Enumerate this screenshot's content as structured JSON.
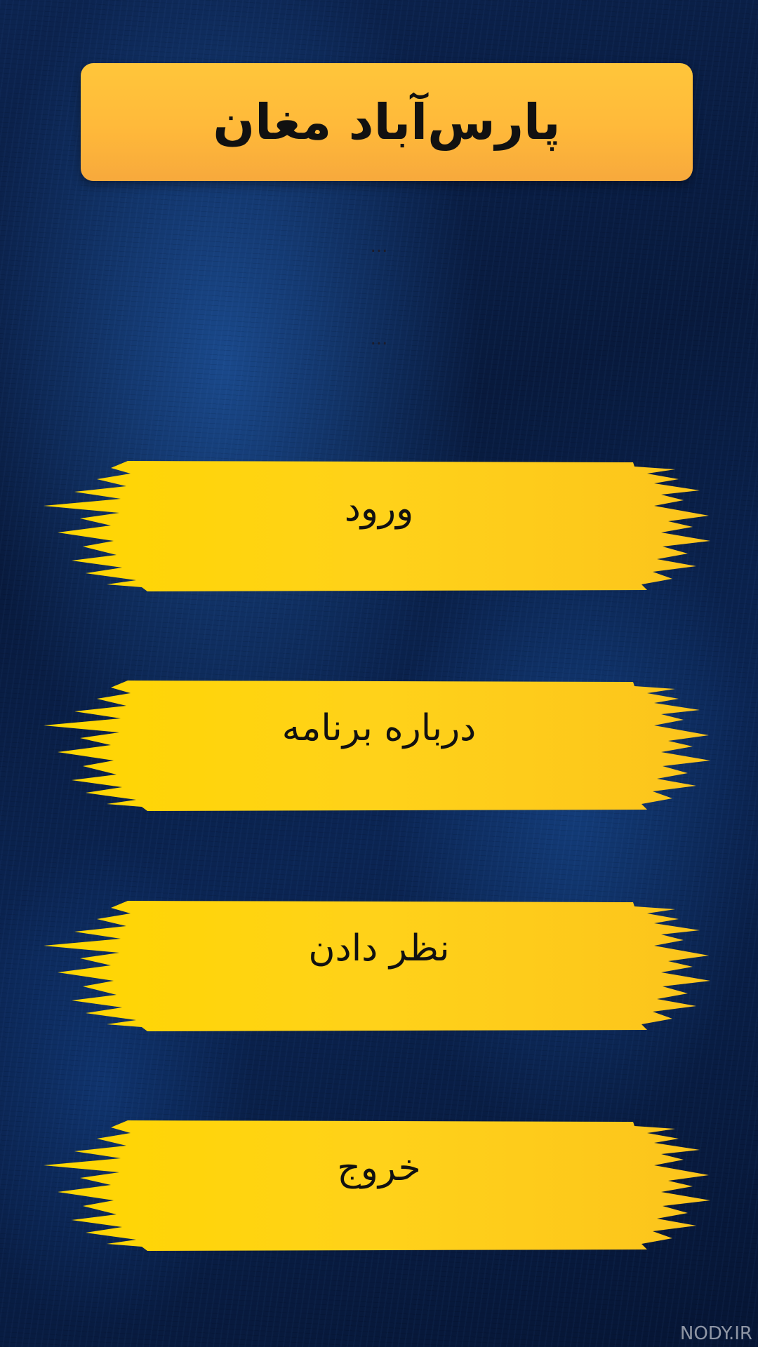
{
  "header": {
    "title": "پارس‌آباد مغان"
  },
  "placeholders": [
    "...",
    "..."
  ],
  "menu": {
    "items": [
      {
        "label": "ورود"
      },
      {
        "label": "درباره برنامه"
      },
      {
        "label": "نظر دادن"
      },
      {
        "label": "خروج"
      }
    ]
  },
  "watermark": "NODY.IR",
  "colors": {
    "background": "#0a1a3a",
    "title_banner": "#ffbe3a",
    "button_yellow": "#ffd21a",
    "text": "#111111"
  }
}
